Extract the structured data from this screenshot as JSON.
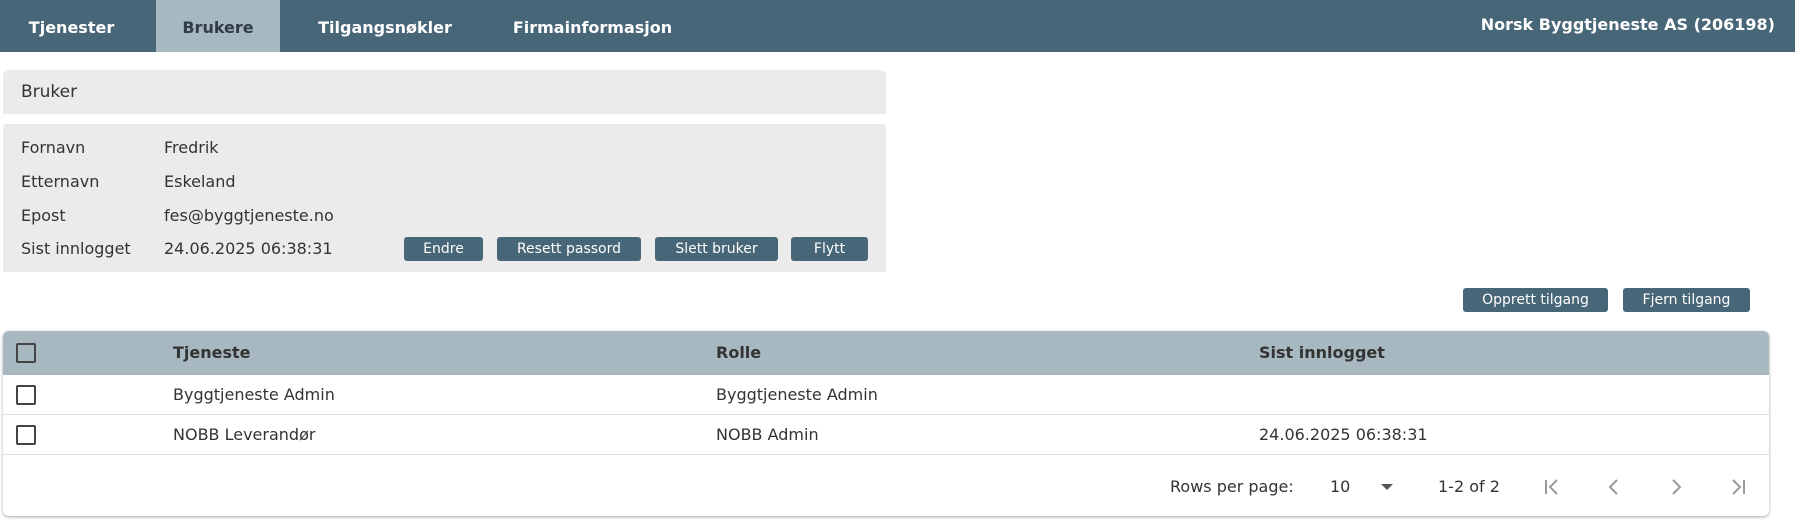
{
  "nav": {
    "tabs": [
      {
        "label": "Tjenester",
        "active": false
      },
      {
        "label": "Brukere",
        "active": true
      },
      {
        "label": "Tilgangsnøkler",
        "active": false
      },
      {
        "label": "Firmainformasjon",
        "active": false
      }
    ],
    "company": "Norsk Byggtjeneste AS (206198)"
  },
  "user_panel": {
    "title": "Bruker",
    "fields": [
      {
        "label": "Fornavn",
        "value": "Fredrik"
      },
      {
        "label": "Etternavn",
        "value": "Eskeland"
      },
      {
        "label": "Epost",
        "value": "fes@byggtjeneste.no"
      },
      {
        "label": "Sist innlogget",
        "value": "24.06.2025 06:38:31"
      }
    ],
    "buttons": {
      "edit": "Endre",
      "reset_password": "Resett passord",
      "delete_user": "Slett bruker",
      "move": "Flytt"
    }
  },
  "access_actions": {
    "create": "Opprett tilgang",
    "remove": "Fjern tilgang"
  },
  "table": {
    "columns": [
      "Tjeneste",
      "Rolle",
      "Sist innlogget"
    ],
    "rows": [
      {
        "service": "Byggtjeneste Admin",
        "role": "Byggtjeneste Admin",
        "last_login": ""
      },
      {
        "service": "NOBB Leverandør",
        "role": "NOBB Admin",
        "last_login": "24.06.2025 06:38:31"
      }
    ],
    "pagination": {
      "rows_per_page_label": "Rows per page:",
      "rows_per_page": "10",
      "range": "1-2 of 2"
    }
  },
  "colors": {
    "primary": "#476677",
    "header_light": "#a7b8c1",
    "panel_bg": "#ebebeb"
  }
}
